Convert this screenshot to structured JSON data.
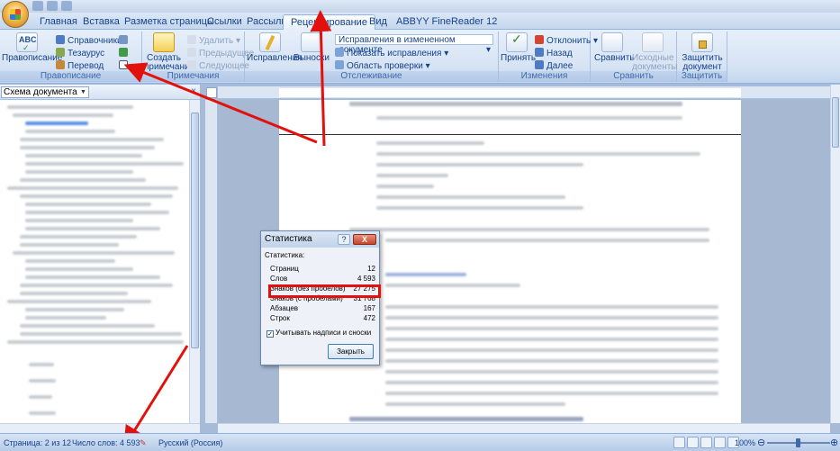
{
  "tabs": [
    {
      "label": "Главная"
    },
    {
      "label": "Вставка"
    },
    {
      "label": "Разметка страницы"
    },
    {
      "label": "Ссылки"
    },
    {
      "label": "Рассылки"
    },
    {
      "label": "Рецензирование"
    },
    {
      "label": "Вид"
    },
    {
      "label": "ABBYY FineReader 12"
    }
  ],
  "ribbon": {
    "proofing": {
      "spelling": "Правописание",
      "reference": "Справочники",
      "thesaurus": "Тезаурус",
      "translate": "Перевод",
      "group_label": "Правописание"
    },
    "comments": {
      "new_comment": "Создать примечание",
      "delete": "Удалить",
      "previous": "Предыдущее",
      "next": "Следующее",
      "group_label": "Примечания"
    },
    "tracking": {
      "track_changes": "Исправления",
      "balloons": "Выноски",
      "display_mode": "Исправления в измененном документе",
      "show_markup": "Показать исправления",
      "reviewing_pane": "Область проверки",
      "group_label": "Отслеживание"
    },
    "changes": {
      "accept": "Принять",
      "reject": "Отклонить",
      "back": "Назад",
      "forward": "Далее",
      "group_label": "Изменения"
    },
    "compare": {
      "compare": "Сравнить",
      "source_docs": "Исходные документы",
      "group_label": "Сравнить"
    },
    "protect": {
      "protect_doc": "Защитить документ",
      "group_label": "Защитить"
    }
  },
  "docmap": {
    "mode": "Схема документа",
    "close": "×"
  },
  "dialog": {
    "title": "Статистика",
    "help": "?",
    "close": "X",
    "group": "Статистика:",
    "rows": [
      {
        "label": "Страниц",
        "value": "12"
      },
      {
        "label": "Слов",
        "value": "4 593"
      },
      {
        "label": "Знаков (без пробелов)",
        "value": "27 275"
      },
      {
        "label": "Знаков (с пробелами)",
        "value": "31 768"
      },
      {
        "label": "Абзацев",
        "value": "167"
      },
      {
        "label": "Строк",
        "value": "472"
      }
    ],
    "checkbox_label": "Учитывать надписи и сноски",
    "checkbox_mark": "✓",
    "close_button": "Закрыть"
  },
  "statusbar": {
    "page": "Страница: 2 из 12",
    "words": "Число слов: 4 593",
    "language": "Русский (Россия)",
    "zoom": "100%"
  },
  "colors": {
    "accent": "#15428b",
    "highlight": "#e3110e"
  }
}
